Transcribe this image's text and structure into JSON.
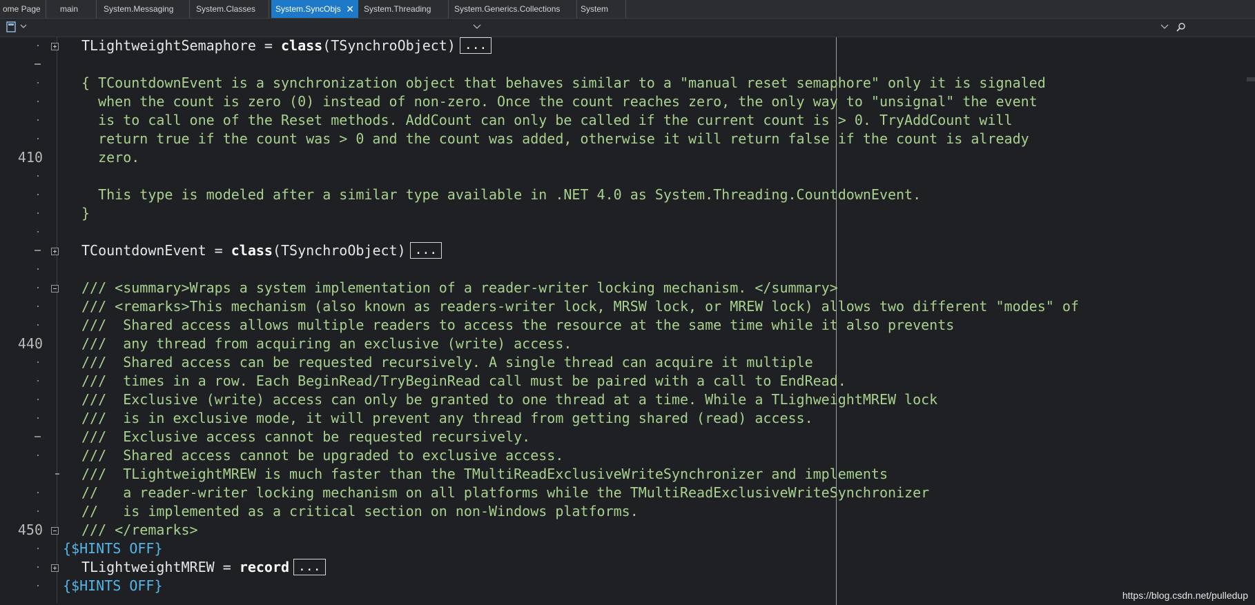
{
  "tabs": [
    {
      "label": "ome Page",
      "active": false
    },
    {
      "label": "main",
      "active": false
    },
    {
      "label": "System.Messaging",
      "active": false
    },
    {
      "label": "System.Classes",
      "active": false
    },
    {
      "label": "System.SyncObjs",
      "active": true
    },
    {
      "label": "System.Threading",
      "active": false
    },
    {
      "label": "System.Generics.Collections",
      "active": false
    },
    {
      "label": "System",
      "active": false
    }
  ],
  "line_numbers": {
    "n410": "410",
    "n440": "440",
    "n450": "450"
  },
  "code": {
    "l1_ident": "TLightweightSemaphore = ",
    "l1_kw": "class",
    "l1_rest": "(TSynchroObject)",
    "ellipsis": "...",
    "c1": "{ TCountdownEvent is a synchronization object that behaves similar to a \"manual reset semaphore\" only it is signaled",
    "c2": "  when the count is zero (0) instead of non-zero. Once the count reaches zero, the only way to \"unsignal\" the event",
    "c3": "  is to call one of the Reset methods. AddCount can only be called if the current count is > 0. TryAddCount will",
    "c4": "  return true if the count was > 0 and the count was added, otherwise it will return false if the count is already",
    "c5": "  zero.",
    "c6": "  This type is modeled after a similar type available in .NET 4.0 as System.Threading.CountdownEvent.",
    "c7": "}",
    "l2_ident": "TCountdownEvent = ",
    "l2_kw": "class",
    "l2_rest": "(TSynchroObject)",
    "d1": "/// <summary>Wraps a system implementation of a reader-writer locking mechanism. </summary>",
    "d2": "/// <remarks>This mechanism (also known as readers-writer lock, MRSW lock, or MREW lock) allows two different \"modes\" of",
    "d3": "///  Shared access allows multiple readers to access the resource at the same time while it also prevents",
    "d4": "///  any thread from acquiring an exclusive (write) access.",
    "d5": "///  Shared access can be requested recursively. A single thread can acquire it multiple",
    "d6": "///  times in a row. Each BeginRead/TryBeginRead call must be paired with a call to EndRead.",
    "d7": "///  Exclusive (write) access can only be granted to one thread at a time. While a TLighweightMREW lock",
    "d8": "///  is in exclusive mode, it will prevent any thread from getting shared (read) access.",
    "d9": "///  Exclusive access cannot be requested recursively.",
    "d10": "///  Shared access cannot be upgraded to exclusive access.",
    "d11": "///  TLightweightMREW is much faster than the TMultiReadExclusiveWriteSynchronizer and implements",
    "d12": "//   a reader-writer locking mechanism on all platforms while the TMultiReadExclusiveWriteSynchronizer",
    "d13": "//   is implemented as a critical section on non-Windows platforms.",
    "d14": "/// </remarks>",
    "h1": "{$HINTS OFF}",
    "l3_ident": "TLightweightMREW = ",
    "l3_kw": "record",
    "h2": "{$HINTS OFF}"
  },
  "watermark": "https://blog.csdn.net/pulledup",
  "colors": {
    "comment": "#a9d18e",
    "directive": "#55b5e8",
    "active_tab": "#1e79c8",
    "background": "#1e2024"
  },
  "icons": [
    "file-icon",
    "dropdown-icon",
    "search-icon",
    "collapse-icon",
    "expand-icon"
  ]
}
